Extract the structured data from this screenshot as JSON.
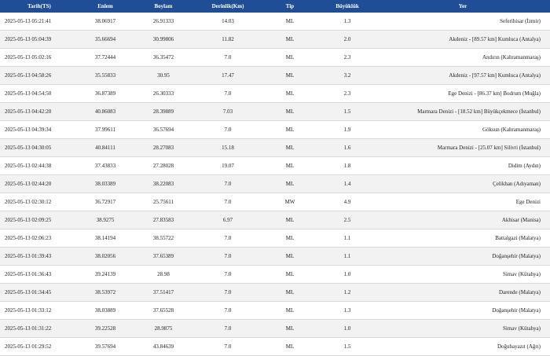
{
  "table": {
    "headers": [
      "Tarih(TS)",
      "Enlem",
      "Boylam",
      "Derinlik(Km)",
      "Tip",
      "Büyüklük",
      "Yer"
    ],
    "rows": [
      [
        "2025-05-13 05:21:41",
        "38.06917",
        "26.91333",
        "14.03",
        "ML",
        "1.3",
        "Seferihisar (İzmir)"
      ],
      [
        "2025-05-13 05:04:39",
        "35.66694",
        "30.99806",
        "11.82",
        "ML",
        "2.0",
        "Akdeniz - [89.57 km] Kumluca (Antalya)"
      ],
      [
        "2025-05-13 05:02:16",
        "37.72444",
        "36.35472",
        "7.0",
        "ML",
        "2.3",
        "Andırın (Kahramanmaraş)"
      ],
      [
        "2025-05-13 04:58:26",
        "35.55833",
        "30.95",
        "17.47",
        "ML",
        "3.2",
        "Akdeniz - [97.57 km] Kumluca (Antalya)"
      ],
      [
        "2025-05-13 04:54:50",
        "36.87389",
        "26.30333",
        "7.0",
        "ML",
        "2.3",
        "Ege Denizi - [86.37 km] Bodrum (Muğla)"
      ],
      [
        "2025-05-13 04:42:20",
        "40.86083",
        "28.39889",
        "7.03",
        "ML",
        "1.5",
        "Marmara Denizi - [18.52 km] Büyükçekmece (İstanbul)"
      ],
      [
        "2025-05-13 04:39:34",
        "37.99611",
        "36.57694",
        "7.0",
        "ML",
        "1.9",
        "Göksun (Kahramanmaraş)"
      ],
      [
        "2025-05-13 04:30:05",
        "40.84111",
        "28.27083",
        "15.18",
        "ML",
        "1.6",
        "Marmara Denizi - [25.07 km] Silivri (İstanbul)"
      ],
      [
        "2025-05-13 02:44:38",
        "37.43833",
        "27.28028",
        "19.07",
        "ML",
        "1.8",
        "Didim (Aydın)"
      ],
      [
        "2025-05-13 02:44:20",
        "38.03389",
        "38.22083",
        "7.0",
        "ML",
        "1.4",
        "Çelikhan (Adıyaman)"
      ],
      [
        "2025-05-13 02:30:12",
        "36.72917",
        "25.75611",
        "7.0",
        "MW",
        "4.9",
        "Ege Denizi"
      ],
      [
        "2025-05-13 02:09:25",
        "38.9275",
        "27.83583",
        "6.97",
        "ML",
        "2.5",
        "Akhisar (Manisa)"
      ],
      [
        "2025-05-13 02:06:23",
        "38.14194",
        "38.55722",
        "7.0",
        "ML",
        "1.1",
        "Battalgazi (Malatya)"
      ],
      [
        "2025-05-13 01:39:43",
        "38.02056",
        "37.65389",
        "7.0",
        "ML",
        "1.1",
        "Doğanşehir (Malatya)"
      ],
      [
        "2025-05-13 01:36:43",
        "39.24139",
        "28.98",
        "7.0",
        "ML",
        "1.0",
        "Simav (Kütahya)"
      ],
      [
        "2025-05-13 01:34:45",
        "38.53972",
        "37.51417",
        "7.0",
        "ML",
        "1.2",
        "Darende (Malatya)"
      ],
      [
        "2025-05-13 01:33:12",
        "38.03889",
        "37.65528",
        "7.0",
        "ML",
        "1.3",
        "Doğanşehir (Malatya)"
      ],
      [
        "2025-05-13 01:31:22",
        "39.22528",
        "28.9875",
        "7.0",
        "ML",
        "1.0",
        "Simav (Kütahya)"
      ],
      [
        "2025-05-13 01:29:52",
        "39.57694",
        "43.84639",
        "7.0",
        "ML",
        "1.5",
        "Doğubayazıt (Ağrı)"
      ]
    ]
  },
  "colors": {
    "header_bg": "#1f4e96",
    "header_text": "#ffffff",
    "row_alt": "#f2f2f2"
  }
}
